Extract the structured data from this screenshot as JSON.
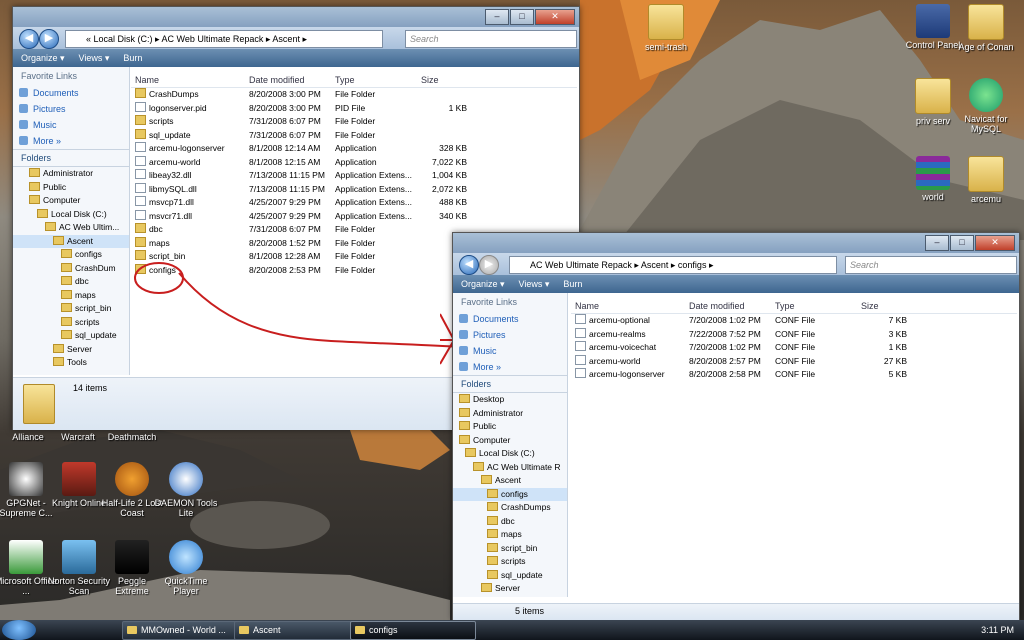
{
  "desktop_icons_right": [
    {
      "label": "semi-trash",
      "icon": "folder-icon"
    },
    {
      "label": "Control Panel",
      "icon": "control-panel-icon"
    },
    {
      "label": "Age of Conan",
      "icon": "folder-icon"
    },
    {
      "label": "priv serv",
      "icon": "folder-icon"
    },
    {
      "label": "Navicat for MySQL",
      "icon": "navicat-icon"
    },
    {
      "label": "world",
      "icon": "winrar-icon"
    },
    {
      "label": "arcemu",
      "icon": "folder-icon"
    }
  ],
  "desktop_icons_left": [
    {
      "label": "Alliance"
    },
    {
      "label": "Warcraft"
    },
    {
      "label": "Deathmatch"
    },
    {
      "label": "GPGNet - Supreme C..."
    },
    {
      "label": "Knight Online"
    },
    {
      "label": "Half-Life 2 Lost Coast"
    },
    {
      "label": "DAEMON Tools Lite"
    },
    {
      "label": "Microsoft Office ..."
    },
    {
      "label": "Norton Security Scan"
    },
    {
      "label": "Peggle Extreme"
    },
    {
      "label": "QuickTime Player"
    }
  ],
  "win1": {
    "breadcrumb": "«  Local Disk (C:)  ▸  AC Web Ultimate Repack  ▸  Ascent  ▸",
    "search_placeholder": "Search",
    "toolbar": {
      "organize": "Organize ▾",
      "views": "Views ▾",
      "burn": "Burn"
    },
    "favorite_links_header": "Favorite Links",
    "favorites": [
      "Documents",
      "Pictures",
      "Music",
      "More  »"
    ],
    "folders_header": "Folders",
    "tree": [
      "Administrator",
      "Public",
      "Computer",
      "Local Disk (C:)",
      "AC Web Ultim...",
      "Ascent",
      "configs",
      "CrashDum",
      "dbc",
      "maps",
      "script_bin",
      "scripts",
      "sql_update",
      "Server",
      "Tools"
    ],
    "columns": [
      "Name",
      "Date modified",
      "Type",
      "Size"
    ],
    "rows": [
      {
        "name": "CrashDumps",
        "date": "8/20/2008 3:00 PM",
        "type": "File Folder",
        "size": ""
      },
      {
        "name": "logonserver.pid",
        "date": "8/20/2008 3:00 PM",
        "type": "PID File",
        "size": "1 KB"
      },
      {
        "name": "scripts",
        "date": "7/31/2008 6:07 PM",
        "type": "File Folder",
        "size": ""
      },
      {
        "name": "sql_update",
        "date": "7/31/2008 6:07 PM",
        "type": "File Folder",
        "size": ""
      },
      {
        "name": "arcemu-logonserver",
        "date": "8/1/2008 12:14 AM",
        "type": "Application",
        "size": "328 KB"
      },
      {
        "name": "arcemu-world",
        "date": "8/1/2008 12:15 AM",
        "type": "Application",
        "size": "7,022 KB"
      },
      {
        "name": "libeay32.dll",
        "date": "7/13/2008 11:15 PM",
        "type": "Application Extens...",
        "size": "1,004 KB"
      },
      {
        "name": "libmySQL.dll",
        "date": "7/13/2008 11:15 PM",
        "type": "Application Extens...",
        "size": "2,072 KB"
      },
      {
        "name": "msvcp71.dll",
        "date": "4/25/2007 9:29 PM",
        "type": "Application Extens...",
        "size": "488 KB"
      },
      {
        "name": "msvcr71.dll",
        "date": "4/25/2007 9:29 PM",
        "type": "Application Extens...",
        "size": "340 KB"
      },
      {
        "name": "dbc",
        "date": "7/31/2008 6:07 PM",
        "type": "File Folder",
        "size": ""
      },
      {
        "name": "maps",
        "date": "8/20/2008 1:52 PM",
        "type": "File Folder",
        "size": ""
      },
      {
        "name": "script_bin",
        "date": "8/1/2008 12:28 AM",
        "type": "File Folder",
        "size": ""
      },
      {
        "name": "configs",
        "date": "8/20/2008 2:53 PM",
        "type": "File Folder",
        "size": ""
      }
    ],
    "status": "14 items"
  },
  "win2": {
    "breadcrumb": "AC Web Ultimate Repack  ▸  Ascent  ▸  configs  ▸",
    "search_placeholder": "Search",
    "toolbar": {
      "organize": "Organize ▾",
      "views": "Views ▾",
      "burn": "Burn"
    },
    "favorite_links_header": "Favorite Links",
    "favorites": [
      "Documents",
      "Pictures",
      "Music",
      "More  »"
    ],
    "folders_header": "Folders",
    "tree": [
      "Desktop",
      "Administrator",
      "Public",
      "Computer",
      "Local Disk (C:)",
      "AC Web Ultimate R",
      "Ascent",
      "configs",
      "CrashDumps",
      "dbc",
      "maps",
      "script_bin",
      "scripts",
      "sql_update",
      "Server"
    ],
    "columns": [
      "Name",
      "Date modified",
      "Type",
      "Size"
    ],
    "rows": [
      {
        "name": "arcemu-optional",
        "date": "7/20/2008 1:02 PM",
        "type": "CONF File",
        "size": "7 KB"
      },
      {
        "name": "arcemu-realms",
        "date": "7/22/2008 7:52 PM",
        "type": "CONF File",
        "size": "3 KB"
      },
      {
        "name": "arcemu-voicechat",
        "date": "7/20/2008 1:02 PM",
        "type": "CONF File",
        "size": "1 KB"
      },
      {
        "name": "arcemu-world",
        "date": "8/20/2008 2:57 PM",
        "type": "CONF File",
        "size": "27 KB"
      },
      {
        "name": "arcemu-logonserver",
        "date": "8/20/2008 2:58 PM",
        "type": "CONF File",
        "size": "5 KB"
      }
    ],
    "status": "5 items"
  },
  "taskbar": {
    "tasks": [
      "MMOwned - World ...",
      "Ascent",
      "configs"
    ],
    "clock": "3:11 PM"
  }
}
